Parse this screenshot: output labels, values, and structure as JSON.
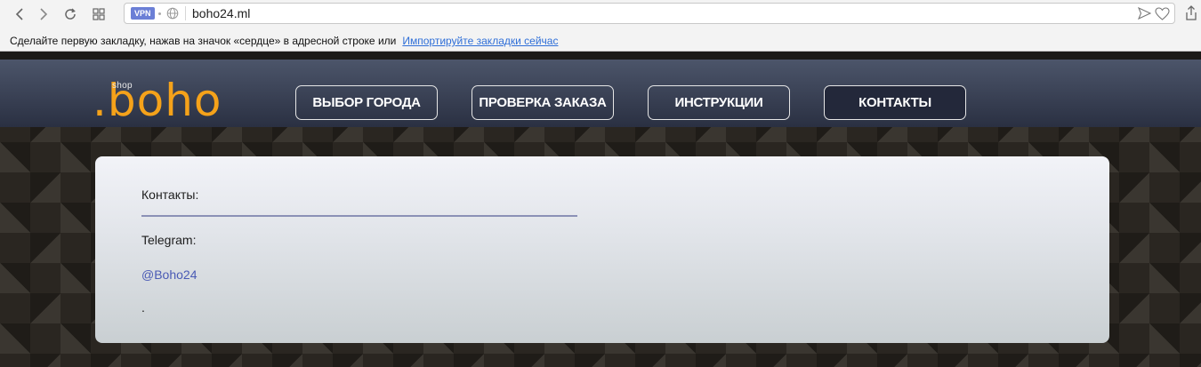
{
  "browser": {
    "vpn_label": "VPN",
    "url": "boho24.ml",
    "bookmarks_prompt": "Сделайте первую закладку, нажав на значок «сердце» в адресной строке или",
    "bookmarks_import_link": "Импортируйте закладки сейчас"
  },
  "site": {
    "logo_small": "shop",
    "logo_main": ".boho",
    "nav": [
      {
        "label": "ВЫБОР ГОРОДА"
      },
      {
        "label": "ПРОВЕРКА ЗАКАЗА"
      },
      {
        "label": "ИНСТРУКЦИИ"
      },
      {
        "label": "КОНТАКТЫ"
      }
    ],
    "content": {
      "heading": "Контакты:",
      "telegram_label": "Telegram:",
      "telegram_handle": "@Boho24",
      "trailing_text": "."
    }
  },
  "colors": {
    "logo_accent": "#f5a21a",
    "header_bg": "#3a4155",
    "link": "#4a5bb5",
    "vpn_badge": "#6b7fd6"
  },
  "icons": [
    "back-arrow-icon",
    "forward-arrow-icon",
    "reload-icon",
    "grid-icon",
    "globe-icon",
    "send-icon",
    "heart-icon",
    "share-icon"
  ]
}
